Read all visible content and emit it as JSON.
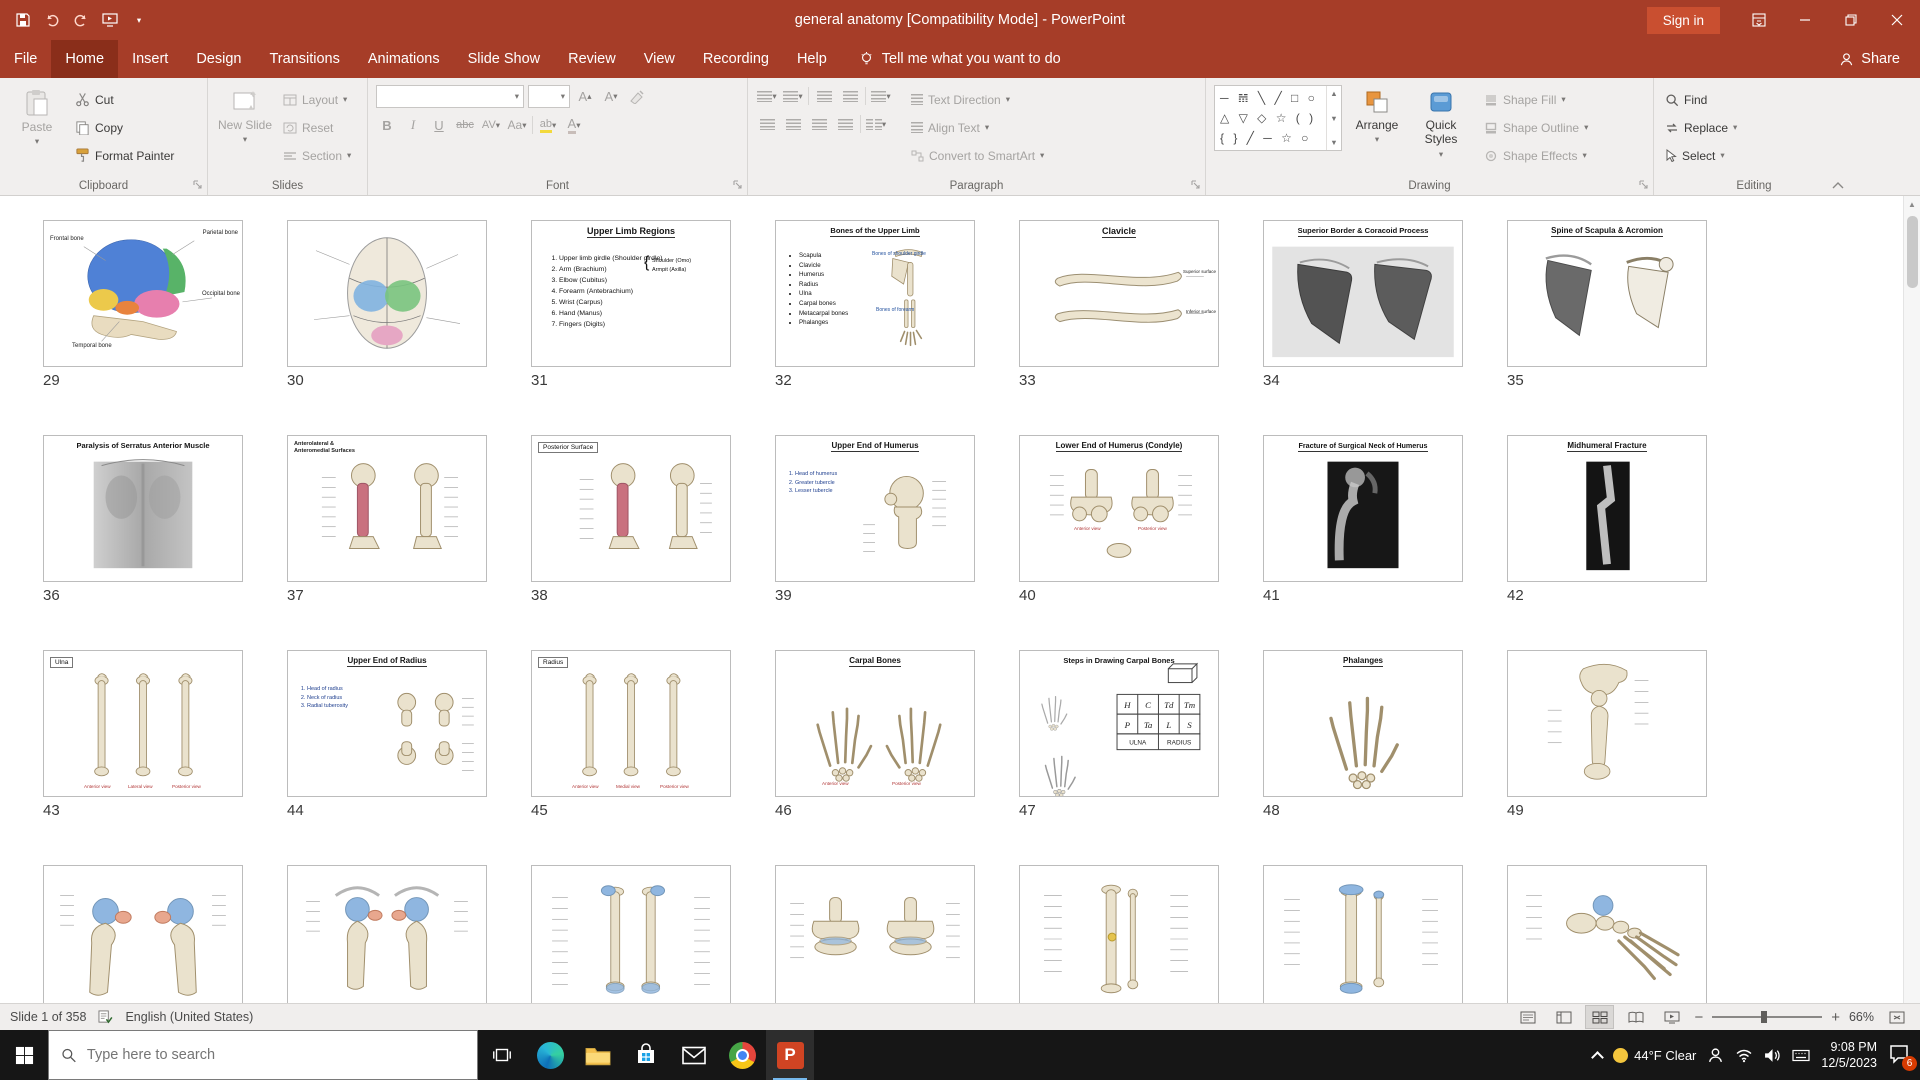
{
  "colors": {
    "titlebar": "#a63d28",
    "tab_active": "#8a2e1a",
    "signin": "#c94f30",
    "ribbon_bg": "#f1efee",
    "disabled": "#a5a3a1",
    "taskbar": "#161616",
    "app_indicator": "#76b9ed",
    "badge": "#d83b01",
    "ppt_icon": "#d04423"
  },
  "titlebar": {
    "title": "general anatomy [Compatibility Mode]  -  PowerPoint",
    "sign_in": "Sign in"
  },
  "ribbon": {
    "tabs": [
      "File",
      "Home",
      "Insert",
      "Design",
      "Transitions",
      "Animations",
      "Slide Show",
      "Review",
      "View",
      "Recording",
      "Help"
    ],
    "active_tab": "Home",
    "tell_me": "Tell me what you want to do",
    "share": "Share",
    "clipboard": {
      "label": "Clipboard",
      "paste": "Paste",
      "cut": "Cut",
      "copy": "Copy",
      "format_painter": "Format Painter"
    },
    "slides_group": {
      "label": "Slides",
      "new_slide": "New Slide",
      "layout": "Layout",
      "reset": "Reset",
      "section": "Section"
    },
    "font": {
      "label": "Font",
      "bold": "B",
      "italic": "I",
      "underline": "U",
      "strike": "abc",
      "char_spacing": "AV",
      "change_case": "Aa",
      "highlight": "ab",
      "font_color": "A",
      "grow": "A",
      "shrink": "A"
    },
    "paragraph": {
      "label": "Paragraph",
      "text_direction": "Text Direction",
      "align_text": "Align Text",
      "smartart": "Convert to SmartArt"
    },
    "drawing": {
      "label": "Drawing",
      "arrange": "Arrange",
      "quick_styles": "Quick Styles",
      "shape_fill": "Shape Fill",
      "shape_outline": "Shape Outline",
      "shape_effects": "Shape Effects",
      "shape_rows": [
        "─ 𝌩 ╲ ╱ □ ○",
        "△ ▽ ◇ ☆ ( )",
        "{ } ╱ ─ ☆ ○"
      ]
    },
    "editing": {
      "label": "Editing",
      "find": "Find",
      "replace": "Replace",
      "select": "Select"
    }
  },
  "slides": [
    {
      "number": "29",
      "kind": "skull_lateral",
      "labels": [
        "Frontal bone",
        "Parietal bone",
        "Occipital bone",
        "Temporal bone"
      ]
    },
    {
      "number": "30",
      "kind": "skull_top"
    },
    {
      "number": "31",
      "kind": "text_list",
      "title": "Upper Limb Regions",
      "items": [
        "Upper limb girdle (Shoulder girdle)",
        "Arm (Brachium)",
        "Elbow (Cubitus)",
        "Forearm (Antebrachium)",
        "Wrist (Carpus)",
        "Hand (Manus)",
        "Fingers (Digits)"
      ],
      "note": [
        "Shoulder (Omo)",
        "Armpit (Axilla)"
      ]
    },
    {
      "number": "32",
      "kind": "bones_list",
      "title": "Bones of the Upper Limb",
      "items": [
        "Scapula",
        "Clavicle",
        "Humerus",
        "Radius",
        "Ulna",
        "Carpal bones",
        "Metacarpal bones",
        "Phalanges"
      ],
      "notes": [
        "Bones of shoulder girdle",
        "Bones of forearm"
      ]
    },
    {
      "number": "33",
      "kind": "clavicle",
      "title": "Clavicle",
      "labels": [
        "Superior surface",
        "Inferior surface"
      ]
    },
    {
      "number": "34",
      "kind": "scapula_dark",
      "title": "Superior Border & Coracoid Process"
    },
    {
      "number": "35",
      "kind": "scapula_light",
      "title": "Spine of Scapula & Acromion"
    },
    {
      "number": "36",
      "kind": "photo_back",
      "title": "Paralysis of Serratus Anterior Muscle"
    },
    {
      "number": "37",
      "kind": "bone_red_pair",
      "title": "Anterolateral & Anteromedial Surfaces"
    },
    {
      "number": "38",
      "kind": "bone_red_boxed",
      "title": "Posterior Surface"
    },
    {
      "number": "39",
      "kind": "humerus_upper",
      "title": "Upper End of Humerus",
      "items": [
        "Head of humerus",
        "Greater tubercle",
        "Lesser tubercle"
      ]
    },
    {
      "number": "40",
      "kind": "humerus_lower",
      "title": "Lower End of Humerus (Condyle)",
      "captions": [
        "Anterior view",
        "Posterior view"
      ]
    },
    {
      "number": "41",
      "kind": "xray_wide",
      "title": "Fracture of Surgical Neck of Humerus"
    },
    {
      "number": "42",
      "kind": "xray_narrow",
      "title": "Midhumeral Fracture"
    },
    {
      "number": "43",
      "kind": "bone_three",
      "title": "Ulna",
      "captions": [
        "Anterior view",
        "Lateral view",
        "Posterior view"
      ]
    },
    {
      "number": "44",
      "kind": "radius_upper",
      "title": "Upper End of Radius",
      "items": [
        "Head of radius",
        "Neck of radius",
        "Radial tuberosity"
      ]
    },
    {
      "number": "45",
      "kind": "bone_three",
      "title": "Radius",
      "captions": [
        "Anterior view",
        "Medial view",
        "Posterior view"
      ]
    },
    {
      "number": "46",
      "kind": "hands_two",
      "title": "Carpal Bones",
      "captions": [
        "Anterior view",
        "Posterior view"
      ]
    },
    {
      "number": "47",
      "kind": "carpal_steps",
      "title": "Steps in Drawing Carpal Bones",
      "grid": [
        [
          "H",
          "C",
          "Td",
          "Tm"
        ],
        [
          "P",
          "Ta",
          "L",
          "S"
        ],
        [
          "ULNA",
          "RADIUS"
        ]
      ]
    },
    {
      "number": "48",
      "kind": "hand_one",
      "title": "Phalanges"
    },
    {
      "number": "49",
      "kind": "leg_bone"
    },
    {
      "number": null,
      "kind": "hip_pair_a"
    },
    {
      "number": null,
      "kind": "hip_pair_b"
    },
    {
      "number": null,
      "kind": "femur_pair"
    },
    {
      "number": null,
      "kind": "knee_pair"
    },
    {
      "number": null,
      "kind": "tibia_labeled"
    },
    {
      "number": null,
      "kind": "tib_fib"
    },
    {
      "number": null,
      "kind": "foot_bones"
    }
  ],
  "statusbar": {
    "slide_counter": "Slide 1 of 358",
    "language": "English (United States)",
    "zoom": "66%"
  },
  "taskbar": {
    "search_placeholder": "Type here to search",
    "weather": "44°F Clear",
    "time": "9:08 PM",
    "date": "12/5/2023",
    "notification_count": "6",
    "powerpoint_letter": "P"
  }
}
